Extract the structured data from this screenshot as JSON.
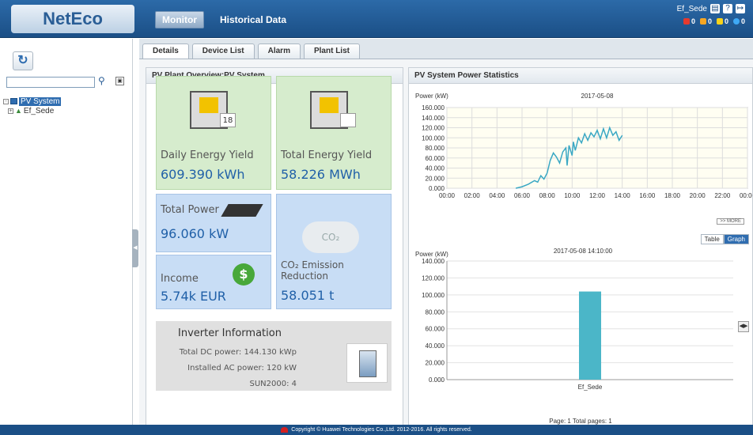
{
  "header": {
    "logo": "NetEco",
    "monitor_label": "Monitor",
    "historical_label": "Historical Data",
    "user": "Ef_Sede",
    "alarms": [
      {
        "color": "#e53a2e",
        "count": "0"
      },
      {
        "color": "#f5a623",
        "count": "0"
      },
      {
        "color": "#f7d21a",
        "count": "0"
      },
      {
        "color": "#3fa9f5",
        "count": "0"
      }
    ]
  },
  "sidebar": {
    "tree": [
      {
        "label": "PV System",
        "selected": true
      },
      {
        "label": "Ef_Sede",
        "selected": false
      }
    ]
  },
  "tabs": [
    "Details",
    "Device List",
    "Alarm",
    "Plant List"
  ],
  "overview": {
    "title": "PV Plant Overview:PV System",
    "daily_yield_label": "Daily Energy Yield",
    "daily_yield_value": "609.390 kWh",
    "calendar_day": "18",
    "total_yield_label": "Total Energy Yield",
    "total_yield_value": "58.226 MWh",
    "total_power_label": "Total Power",
    "total_power_value": "96.060 kW",
    "income_label": "Income",
    "income_value": "5.74k EUR",
    "co2_label": "CO₂ Emission Reduction",
    "co2_value": "58.051 t",
    "co2_cloud_text": "CO₂",
    "inverter_title": "Inverter Information",
    "dc_power": "Total DC power:  144.130 kWp",
    "ac_power": "Installed AC power:  120 kW",
    "sun2000": "SUN2000:  4"
  },
  "stats": {
    "title": "PV System Power Statistics",
    "more_label": ">> MORE",
    "toggle_table": "Table",
    "toggle_graph": "Graph",
    "pagination": "Page: 1   Total pages: 1"
  },
  "chart_data": [
    {
      "type": "line",
      "title": "2017-05-08",
      "ylabel": "Power (kW)",
      "xlabel": "",
      "ylim": [
        0,
        160
      ],
      "yticks": [
        "160.000",
        "140.000",
        "120.000",
        "100.000",
        "80.000",
        "60.000",
        "40.000",
        "20.000",
        "0.000"
      ],
      "xticks": [
        "00:00",
        "02:00",
        "04:00",
        "06:00",
        "08:00",
        "10:00",
        "12:00",
        "14:00",
        "16:00",
        "18:00",
        "20:00",
        "22:00",
        "00:00"
      ],
      "series": [
        {
          "x": [
            5.5,
            6.0,
            6.5,
            7.0,
            7.25,
            7.5,
            7.75,
            8.0,
            8.25,
            8.5,
            8.75,
            9.0,
            9.25,
            9.5,
            9.6,
            9.75,
            10.0,
            10.1,
            10.25,
            10.5,
            10.75,
            11.0,
            11.25,
            11.5,
            11.75,
            12.0,
            12.25,
            12.5,
            12.75,
            13.0,
            13.25,
            13.5,
            13.75,
            14.0
          ],
          "y": [
            0,
            3,
            8,
            15,
            12,
            25,
            18,
            30,
            55,
            70,
            62,
            50,
            72,
            80,
            45,
            85,
            65,
            92,
            75,
            100,
            90,
            108,
            95,
            110,
            102,
            115,
            98,
            118,
            100,
            120,
            105,
            112,
            95,
            105
          ]
        }
      ]
    },
    {
      "type": "bar",
      "title": "2017-05-08 14:10:00",
      "ylabel": "Power (kW)",
      "ylim": [
        0,
        140
      ],
      "yticks": [
        "140.000",
        "120.000",
        "100.000",
        "80.000",
        "60.000",
        "40.000",
        "20.000",
        "0.000"
      ],
      "categories": [
        "Ef_Sede"
      ],
      "values": [
        104
      ]
    }
  ],
  "footer": "Copyright © Huawei Technologies Co.,Ltd. 2012-2016. All rights reserved."
}
